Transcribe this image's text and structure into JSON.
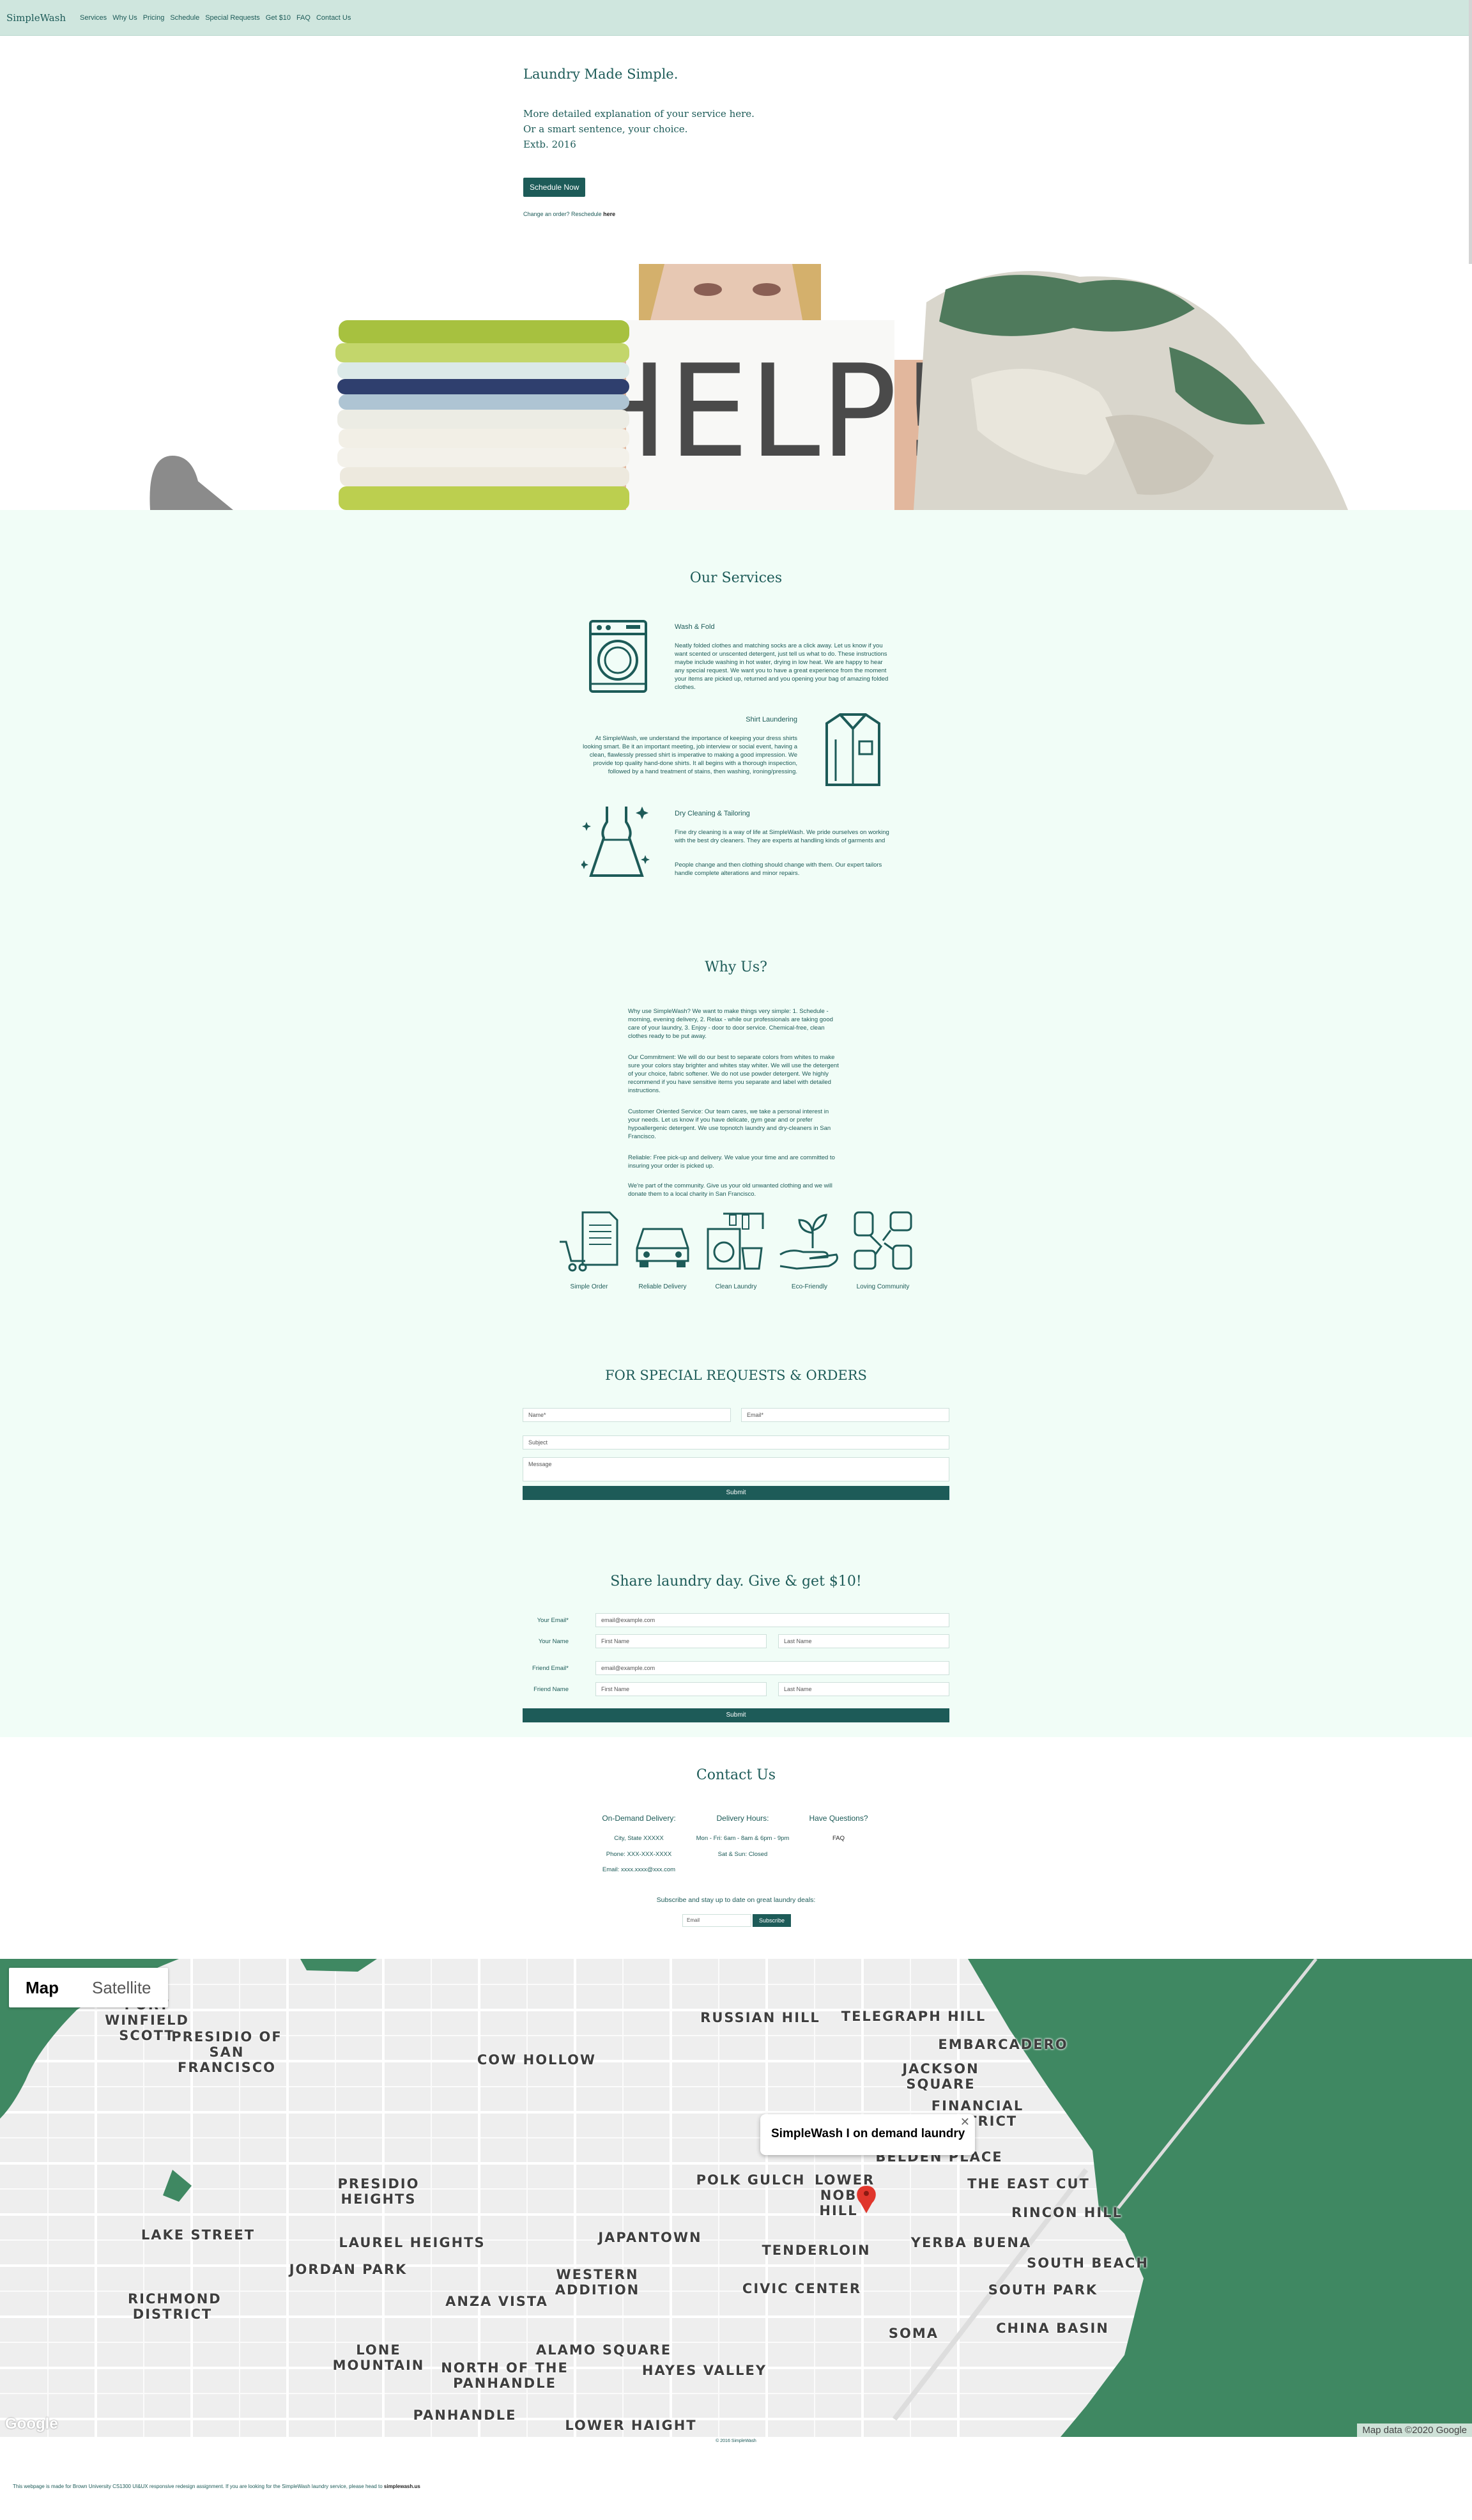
{
  "nav": {
    "brand": "SimpleWash",
    "items": [
      "Services",
      "Why Us",
      "Pricing",
      "Schedule",
      "Special Requests",
      "Get $10",
      "FAQ",
      "Contact Us"
    ]
  },
  "hero": {
    "title": "Laundry Made Simple.",
    "lines": [
      "More detailed explanation of your service here.",
      "Or a smart sentence, your choice.",
      "Extb. 2016"
    ],
    "button": "Schedule Now",
    "change_prefix": "Change an order? Reschedule ",
    "change_link": "here",
    "banner_sign": "HELP!"
  },
  "services": {
    "title": "Our Services",
    "items": [
      {
        "icon": "washing-machine-icon",
        "title": "Wash & Fold",
        "text": "Neatly folded clothes and matching socks are a click away. Let us know if you want scented or unscented detergent, just tell us what to do. These instructions maybe include washing in hot water, drying in low heat. We are happy to hear any special request. We want you to have a great experience from the moment your items are picked up, returned and you opening your bag of amazing folded clothes."
      },
      {
        "icon": "shirt-icon",
        "title": "Shirt Laundering",
        "text": "At SimpleWash, we understand the importance of keeping your dress shirts looking smart. Be it an important meeting, job interview or social event, having a clean, flawlessly pressed shirt is imperative to making a good impression. We provide top quality hand-done shirts. It all begins with a thorough inspection, followed by a hand treatment of stains, then washing, ironing/pressing."
      },
      {
        "icon": "dress-icon",
        "title": "Dry Cleaning & Tailoring",
        "text": "Fine dry cleaning is a way of life at SimpleWash. We pride ourselves on working with the best dry cleaners. They are experts at handling kinds of garments and",
        "text2": "People change and then clothing should change with them. Our expert tailors handle complete alterations and minor repairs."
      }
    ]
  },
  "why": {
    "title": "Why Us?",
    "paragraphs": [
      "Why use SimpleWash? We want to make things very simple: 1. Schedule - morning, evening delivery, 2. Relax - while our professionals are taking good care of your laundry, 3. Enjoy - door to door service. Chemical-free, clean clothes ready to be put away.",
      "Our Commitment: We will do our best to separate colors from whites to make sure your colors stay brighter and whites stay whiter. We will use the detergent of your choice, fabric softener. We do not use powder detergent. We highly recommend if you have sensitive items you separate and label with detailed instructions.",
      "Customer Oriented Service: Our team cares, we take a personal interest in your needs. Let us know if you have delicate, gym gear and or prefer hypoallergenic detergent. We use topnotch laundry and dry-cleaners in San Francisco.",
      "Reliable: Free pick-up and delivery. We value your time and are committed to insuring your order is picked up.",
      "We're part of the community. Give us your old unwanted clothing and we will donate them to a local charity in San Francisco."
    ],
    "features": [
      {
        "icon": "simple-order-icon",
        "label": "Simple Order"
      },
      {
        "icon": "delivery-car-icon",
        "label": "Reliable Delivery"
      },
      {
        "icon": "clean-laundry-icon",
        "label": "Clean Laundry"
      },
      {
        "icon": "eco-friendly-icon",
        "label": "Eco-Friendly"
      },
      {
        "icon": "community-hands-icon",
        "label": "Loving Community"
      }
    ]
  },
  "special": {
    "title": "FOR SPECIAL REQUESTS & ORDERS",
    "name_ph": "Name*",
    "email_ph": "Email*",
    "subject_ph": "Subject",
    "message_ph": "Message",
    "submit": "Submit"
  },
  "share": {
    "title": "Share laundry day. Give & get $10!",
    "your_email_label": "Your Email*",
    "your_email_ph": "email@example.com",
    "your_name_label": "Your Name",
    "first_ph": "First Name",
    "last_ph": "Last Name",
    "friend_email_label": "Friend Email*",
    "friend_email_ph": "email@example.com",
    "friend_name_label": "Friend Name",
    "friend_first_ph": "First Name",
    "friend_last_ph": "Last Name",
    "submit": "Submit"
  },
  "contact": {
    "title": "Contact Us",
    "col1": {
      "head": "On-Demand Delivery:",
      "lines": [
        "City, State XXXXX",
        "Phone: XXX-XXX-XXXX",
        "Email: xxxx.xxxx@xxx.com"
      ]
    },
    "col2": {
      "head": "Delivery Hours:",
      "lines": [
        "Mon - Fri: 6am - 8am & 6pm - 9pm",
        "Sat & Sun: Closed"
      ]
    },
    "col3": {
      "head": "Have Questions?",
      "lines": [
        "FAQ"
      ]
    },
    "subscribe_text": "Subscribe and stay up to date on great laundry deals:",
    "email_ph": "Email",
    "subscribe_btn": "Subscribe"
  },
  "map": {
    "tab_map": "Map",
    "tab_satellite": "Satellite",
    "info": "SimpleWash I on demand laundry",
    "credit": "Map data ©2020 Google",
    "logo": "Google",
    "labels": [
      "PRESIDIO OF SAN FRANCISCO",
      "COW HOLLOW",
      "RUSSIAN HILL",
      "TELEGRAPH HILL",
      "EMBARCADERO",
      "JACKSON SQUARE",
      "FINANCIAL DISTRICT",
      "BELDEN PLACE",
      "PRESIDIO HEIGHTS",
      "POLK GULCH",
      "LOWER NOB HILL",
      "THE EAST CUT",
      "RINCON HILL",
      "LAKE STREET",
      "LAUREL HEIGHTS",
      "JAPANTOWN",
      "TENDERLOIN",
      "YERBA BUENA",
      "JORDAN PARK",
      "WESTERN ADDITION",
      "SOUTH BEACH",
      "RICHMOND DISTRICT",
      "ANZA VISTA",
      "CIVIC CENTER",
      "SOUTH PARK",
      "SOMA",
      "CHINA BASIN",
      "LONE MOUNTAIN",
      "ALAMO SQUARE",
      "NORTH OF THE PANHANDLE",
      "HAYES VALLEY",
      "PANHANDLE",
      "LOWER HAIGHT",
      "PORT WINFIELD SCOTT"
    ]
  },
  "footer": {
    "copyright": "© 2016 SimpleWash",
    "note_prefix": "This webpage is made for Brown University CS1300 UI&UX responsive redesign assignment. If you are looking for the SimpleWash laundry service, please head to ",
    "note_link": "simplewash.us"
  },
  "colors": {
    "brand": "#1d5b58",
    "nav_bg": "#cfe6de",
    "mint_bg": "#f1fdf7",
    "water": "#3f8862",
    "pin": "#e0362c"
  }
}
